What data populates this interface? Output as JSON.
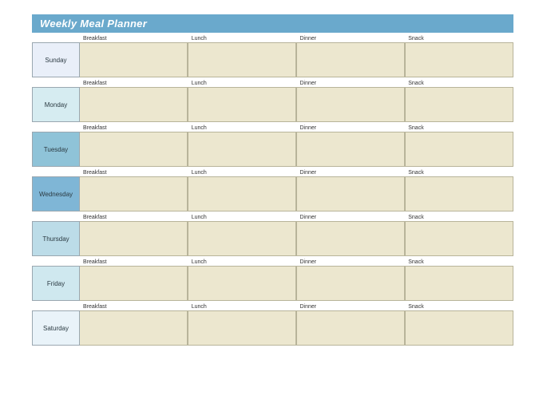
{
  "title": "Weekly Meal Planner",
  "meal_columns": [
    "Breakfast",
    "Lunch",
    "Dinner",
    "Snack"
  ],
  "days": [
    {
      "name": "Sunday",
      "meals": [
        "",
        "",
        "",
        ""
      ]
    },
    {
      "name": "Monday",
      "meals": [
        "",
        "",
        "",
        ""
      ]
    },
    {
      "name": "Tuesday",
      "meals": [
        "",
        "",
        "",
        ""
      ]
    },
    {
      "name": "Wednesday",
      "meals": [
        "",
        "",
        "",
        ""
      ]
    },
    {
      "name": "Thursday",
      "meals": [
        "",
        "",
        "",
        ""
      ]
    },
    {
      "name": "Friday",
      "meals": [
        "",
        "",
        "",
        ""
      ]
    },
    {
      "name": "Saturday",
      "meals": [
        "",
        "",
        "",
        ""
      ]
    }
  ],
  "colors": {
    "title_bar": "#6aa9cc",
    "cell_fill": "#ece7cf",
    "cell_border": "#b8b49a",
    "day_border": "#9aa7b0",
    "day_fills": [
      "#e9eff9",
      "#d6ecf1",
      "#8fc3d8",
      "#7fb6d6",
      "#bcdce8",
      "#cfe8ef",
      "#e9f3f9"
    ]
  }
}
